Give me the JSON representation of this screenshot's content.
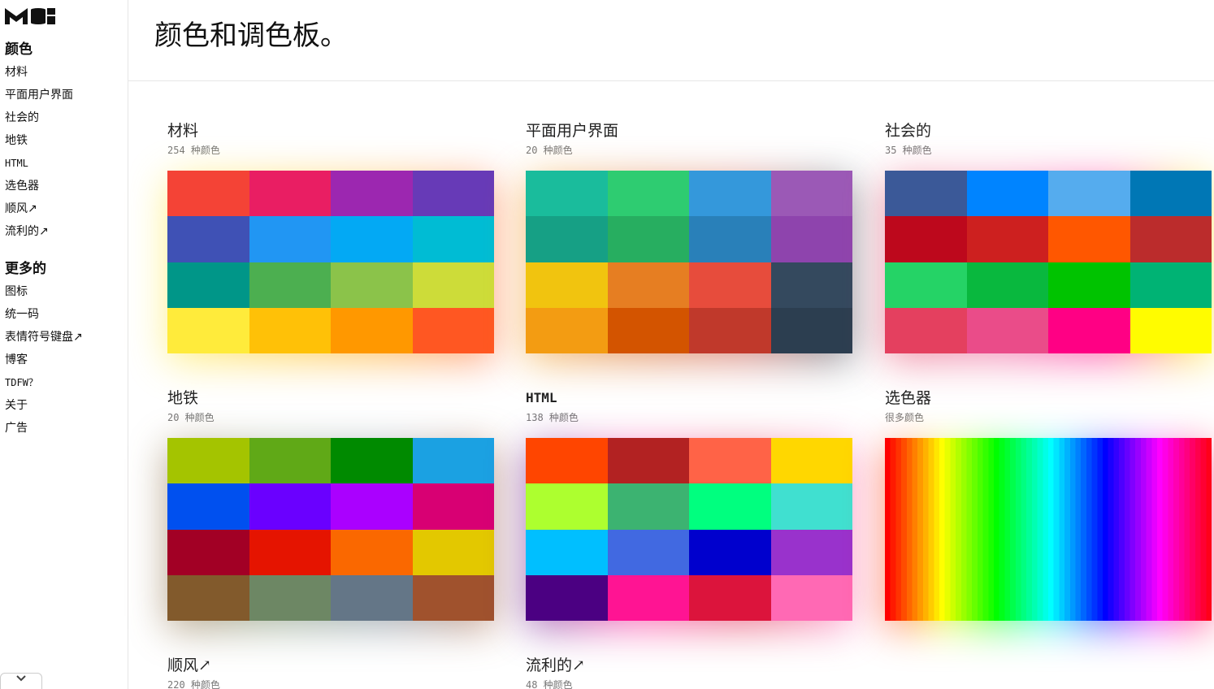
{
  "app": {
    "logo_alt": "MUI logo"
  },
  "sidebar": {
    "sections": [
      {
        "heading": "颜色",
        "items": [
          {
            "label": "材料",
            "mono": false
          },
          {
            "label": "平面用户界面",
            "mono": false
          },
          {
            "label": "社会的",
            "mono": false
          },
          {
            "label": "地铁",
            "mono": false
          },
          {
            "label": "HTML",
            "mono": true
          },
          {
            "label": "选色器",
            "mono": false
          },
          {
            "label": "顺风↗",
            "mono": false
          },
          {
            "label": "流利的↗",
            "mono": false
          }
        ]
      },
      {
        "heading": "更多的",
        "items": [
          {
            "label": "图标",
            "mono": false
          },
          {
            "label": "统一码",
            "mono": false
          },
          {
            "label": "表情符号键盘↗",
            "mono": false
          },
          {
            "label": "博客",
            "mono": false
          },
          {
            "label": "TDFW？",
            "mono": true
          },
          {
            "label": "关于",
            "mono": false
          },
          {
            "label": "广告",
            "mono": false
          }
        ]
      }
    ],
    "toggle_icon": "chevron-down-icon"
  },
  "main": {
    "title": "颜色和调色板。",
    "cards": [
      {
        "title": "材料",
        "subtitle": "254 种颜色",
        "mono_title": false,
        "colors": [
          "#F44336",
          "#E91E63",
          "#9C27B0",
          "#673AB7",
          "#3F51B5",
          "#2196F3",
          "#03A9F4",
          "#00BCD4",
          "#009688",
          "#4CAF50",
          "#8BC34A",
          "#CDDC39",
          "#FFEB3B",
          "#FFC107",
          "#FF9800",
          "#FF5722"
        ]
      },
      {
        "title": "平面用户界面",
        "subtitle": "20 种颜色",
        "mono_title": false,
        "colors": [
          "#1ABC9C",
          "#2ECC71",
          "#3498DB",
          "#9B59B6",
          "#16A085",
          "#27AE60",
          "#2980B9",
          "#8E44AD",
          "#F1C40F",
          "#E67E22",
          "#E74C3C",
          "#34495E",
          "#F39C12",
          "#D35400",
          "#C0392B",
          "#2C3E50"
        ]
      },
      {
        "title": "社会的",
        "subtitle": "35 种颜色",
        "mono_title": false,
        "colors": [
          "#3B5998",
          "#0084FF",
          "#55ACEE",
          "#0077B5",
          "#BD081C",
          "#CD201F",
          "#FF5700",
          "#BB2C2C",
          "#25D366",
          "#09B83E",
          "#00C300",
          "#00B374",
          "#E4405F",
          "#EA4C89",
          "#FF0084",
          "#FFFC00"
        ]
      },
      {
        "title": "地铁",
        "subtitle": "20 种颜色",
        "mono_title": false,
        "colors": [
          "#A4C400",
          "#60A917",
          "#008A00",
          "#1BA1E2",
          "#0050EF",
          "#6A00FF",
          "#AA00FF",
          "#D80073",
          "#A20025",
          "#E51400",
          "#FA6800",
          "#E3C800",
          "#825A2C",
          "#6D8764",
          "#647687",
          "#A0522D"
        ]
      },
      {
        "title": "HTML",
        "subtitle": "138 种颜色",
        "mono_title": true,
        "colors": [
          "#FF4500",
          "#B22222",
          "#FF6347",
          "#FFD700",
          "#ADFF2F",
          "#3CB371",
          "#00FF7F",
          "#40E0D0",
          "#00BFFF",
          "#4169E1",
          "#0000CD",
          "#9932CC",
          "#4B0082",
          "#FF1493",
          "#DC143C",
          "#FF69B4"
        ]
      },
      {
        "title": "选色器",
        "subtitle": "很多颜色",
        "mono_title": false,
        "rainbow": true
      },
      {
        "title": "顺风↗",
        "subtitle": "220 种颜色",
        "mono_title": false
      },
      {
        "title": "流利的↗",
        "subtitle": "48 种颜色",
        "mono_title": false
      }
    ]
  }
}
